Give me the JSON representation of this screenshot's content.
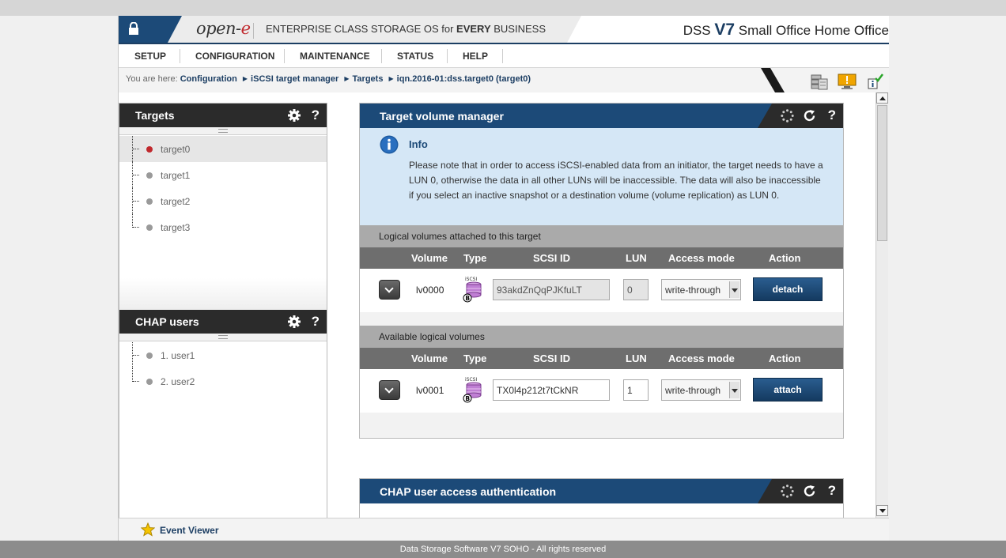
{
  "header": {
    "logo_prefix": "open-",
    "logo_suffix": "e",
    "tagline_a": "ENTERPRISE CLASS STORAGE OS for ",
    "tagline_b": "EVERY",
    "tagline_c": " BUSINESS",
    "product_a": "DSS ",
    "product_b": "V7",
    "product_c": " Small Office Home Office"
  },
  "menu": [
    "SETUP",
    "CONFIGURATION",
    "MAINTENANCE",
    "STATUS",
    "HELP"
  ],
  "breadcrumb": {
    "prefix": "You are here:",
    "items": [
      "Configuration",
      "iSCSI target manager",
      "Targets",
      "iqn.2016-01:dss.target0 (target0)"
    ]
  },
  "targets_panel": {
    "title": "Targets",
    "help": "?",
    "items": [
      "target0",
      "target1",
      "target2",
      "target3"
    ]
  },
  "chap_panel": {
    "title": "CHAP users",
    "help": "?",
    "items": [
      "1. user1",
      "2. user2"
    ]
  },
  "tvm": {
    "title": "Target volume manager",
    "help": "?",
    "info_title": "Info",
    "info_text": "Please note that in order to access iSCSI-enabled data from an initiator, the target needs to have a LUN 0, otherwise the data in all other LUNs will be inaccessible. The data will also be inaccessible if you select an inactive snapshot or a destination volume (volume replication) as LUN 0.",
    "columns": [
      "Volume",
      "Type",
      "SCSI ID",
      "LUN",
      "Access mode",
      "Action"
    ],
    "attached_title": "Logical volumes attached to this target",
    "attached": {
      "volume": "lv0000",
      "type_label": "iSCSI",
      "scsi_id": "93akdZnQqPJKfuLT",
      "lun": "0",
      "access_mode": "write-through",
      "action": "detach"
    },
    "available_title": "Available logical volumes",
    "available": {
      "volume": "lv0001",
      "type_label": "iSCSI",
      "scsi_id": "TX0l4p212t7tCkNR",
      "lun": "1",
      "access_mode": "write-through",
      "action": "attach"
    }
  },
  "chap_auth": {
    "title": "CHAP user access authentication",
    "help": "?"
  },
  "event_viewer": "Event Viewer",
  "footer": "Data Storage Software V7 SOHO - All rights reserved",
  "colors": {
    "primary_blue": "#1c4a78",
    "dark_header": "#2b2b2b",
    "info_bg": "#d5e7f6",
    "status_red": "#c0282d"
  }
}
